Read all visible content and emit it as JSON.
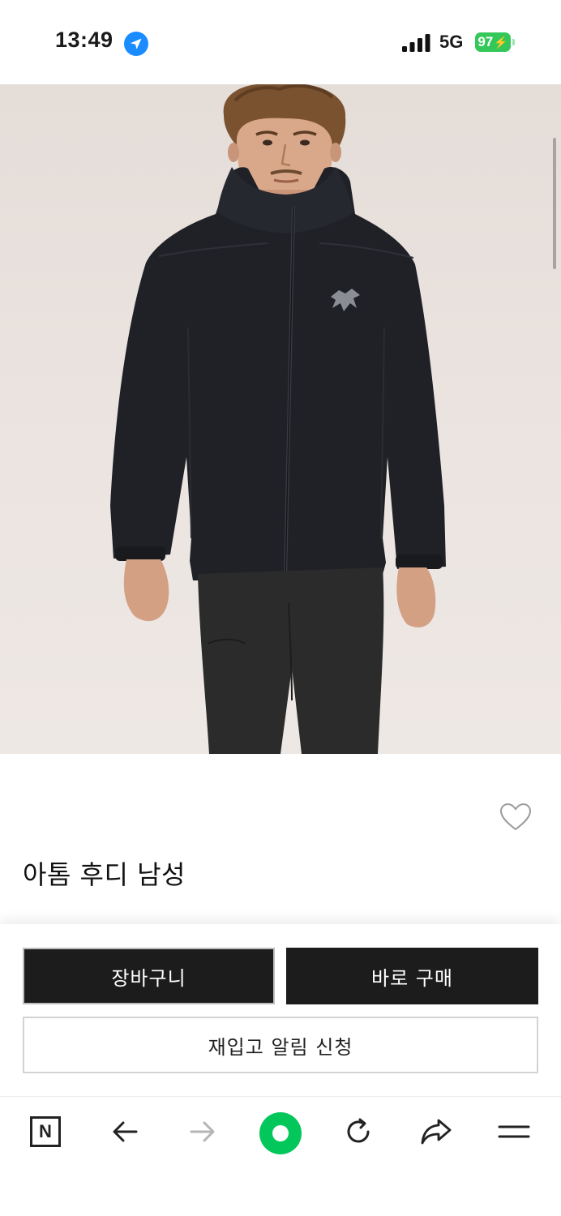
{
  "status_bar": {
    "time": "13:49",
    "network": "5G",
    "battery": "97",
    "location_icon": "location-arrow-icon",
    "signal_icon": "cellular-signal-icon"
  },
  "product": {
    "image_alt": "man wearing black insulated hoodie jacket with bird logo",
    "title": "아톰 후디 남성",
    "wishlist_icon": "heart-outline-icon"
  },
  "actions": {
    "cart_label": "장바구니",
    "buy_now_label": "바로 구매",
    "restock_label": "재입고 알림 신청"
  },
  "browser_toolbar": {
    "naver_label": "N",
    "icons": [
      "naver-n-icon",
      "back-arrow-icon",
      "forward-arrow-icon",
      "home-circle-icon",
      "reload-icon",
      "share-icon",
      "menu-icon"
    ]
  },
  "colors": {
    "accent_green": "#03c75a",
    "battery_green": "#34c759",
    "button_dark": "#1c1c1c",
    "location_blue": "#1a8cff"
  }
}
